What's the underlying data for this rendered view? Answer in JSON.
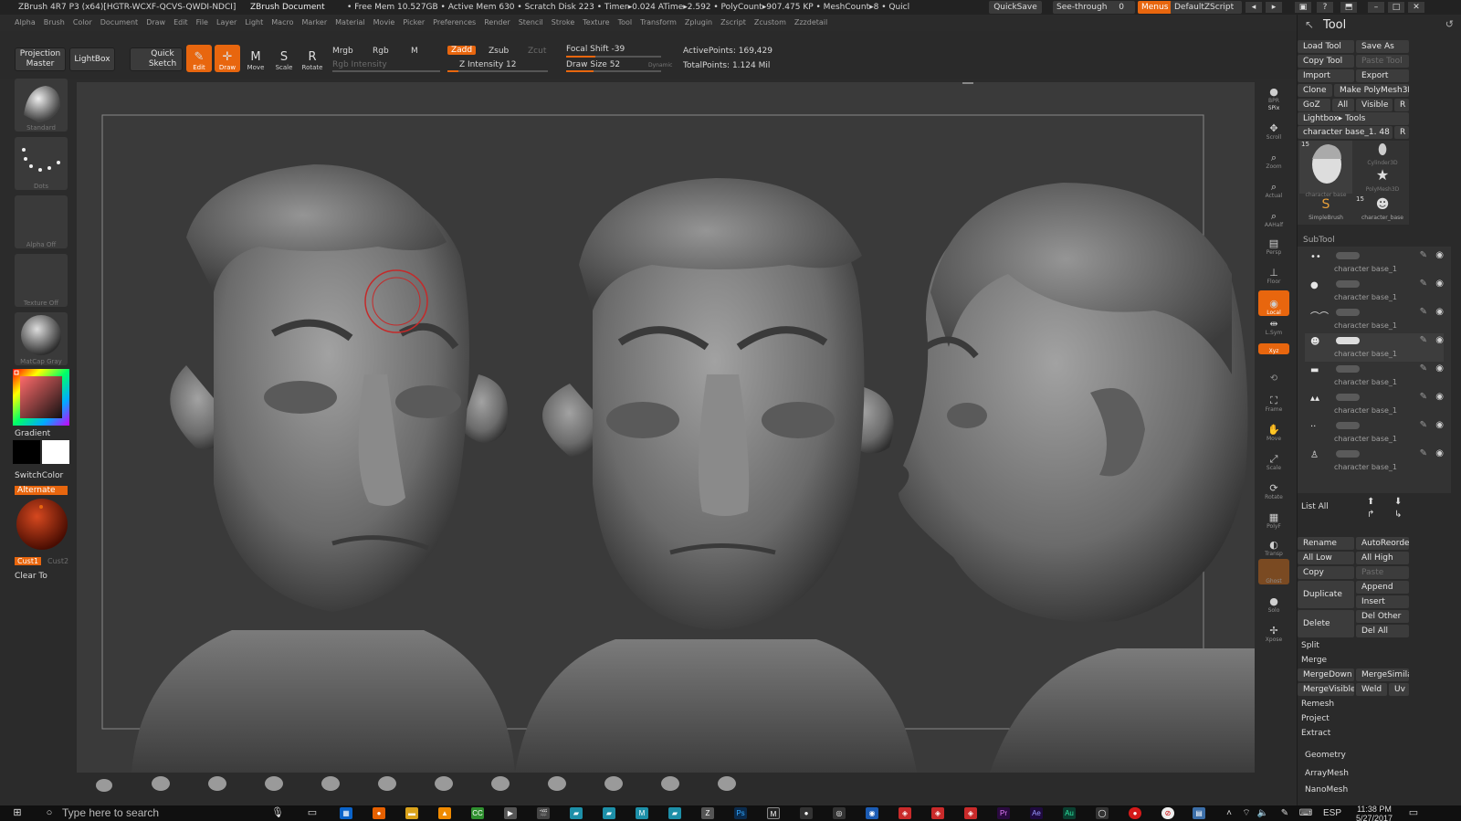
{
  "titlebar": {
    "app_title": "ZBrush 4R7 P3 (x64)[HGTR-WCXF-QCVS-QWDI-NDCI]",
    "document": "ZBrush Document",
    "status": "• Free Mem 10.527GB • Active Mem 630 • Scratch Disk 223 • Timer▸0.024 ATime▸2.592 • PolyCount▸907.475 KP • MeshCount▸8 • Quicl",
    "quicksave": "QuickSave",
    "see_through": "See-through",
    "see_through_value": "0",
    "menus": "Menus",
    "default_zscript": "DefaultZScript"
  },
  "menubar": [
    "Alpha",
    "Brush",
    "Color",
    "Document",
    "Draw",
    "Edit",
    "File",
    "Layer",
    "Light",
    "Macro",
    "Marker",
    "Material",
    "Movie",
    "Picker",
    "Preferences",
    "Render",
    "Stencil",
    "Stroke",
    "Texture",
    "Tool",
    "Transform",
    "Zplugin",
    "Zscript",
    "Zcustom",
    "Zzzdetail"
  ],
  "shelf": {
    "projection_master": "Projection Master",
    "lightbox": "LightBox",
    "quick_sketch": "Quick Sketch",
    "edit": "Edit",
    "draw": "Draw",
    "move": "Move",
    "scale": "Scale",
    "rotate": "Rotate",
    "mrgb": "Mrgb",
    "rgb": "Rgb",
    "m": "M",
    "rgb_intensity": "Rgb Intensity",
    "zadd": "Zadd",
    "zsub": "Zsub",
    "zcut": "Zcut",
    "z_intensity": "Z Intensity 12",
    "focal_shift": "Focal Shift -39",
    "draw_size": "Draw Size 52",
    "dynamic": "Dynamic",
    "active_points": "ActivePoints: 169,429",
    "total_points": "TotalPoints: 1.124 Mil"
  },
  "lefttray": {
    "brush": "Standard",
    "stroke": "Dots",
    "alpha": "Alpha Off",
    "texture": "Texture Off",
    "material": "MatCap Gray",
    "gradient": "Gradient",
    "switchcolor": "SwitchColor",
    "alternate": "Alternate",
    "cust1": "Cust1",
    "cust2": "Cust2",
    "clear_to": "Clear To"
  },
  "rightdock": [
    "BPR",
    "SPix",
    "Scroll",
    "Zoom",
    "Actual",
    "AAHalf",
    "Persp",
    "Floor",
    "Local",
    "L.Sym",
    "Xyz",
    "Frame",
    "Move",
    "Scale",
    "Rotate",
    "PolyF",
    "Transp",
    "Ghost",
    "Solo",
    "Xpose"
  ],
  "tool": {
    "title": "Tool",
    "load_tool": "Load Tool",
    "save_as": "Save As",
    "copy_tool": "Copy Tool",
    "paste_tool": "Paste Tool",
    "import": "Import",
    "export": "Export",
    "clone": "Clone",
    "make_polymesh": "Make PolyMesh3D",
    "goz": "GoZ",
    "all": "All",
    "visible": "Visible",
    "r": "R",
    "lightbox_tools": "Lightbox▸ Tools",
    "current_tool": "character base_1. 48",
    "thumbs": [
      "character base",
      "Cylinder3D",
      "PolyMesh3D",
      "SimpleBrush",
      "character_base"
    ],
    "thumb_counts": [
      "15",
      "15"
    ],
    "subtool_header": "SubTool",
    "subtools": [
      "character base_1",
      "character base_1",
      "character base_1",
      "character base_1",
      "character base_1",
      "character base_1",
      "character base_1",
      "character base_1"
    ],
    "list_all": "List All",
    "rename": "Rename",
    "autoreorder": "AutoReorde",
    "all_low": "All Low",
    "all_high": "All High",
    "copy": "Copy",
    "paste": "Paste",
    "duplicate": "Duplicate",
    "append": "Append",
    "insert": "Insert",
    "delete": "Delete",
    "del_other": "Del Other",
    "del_all": "Del All",
    "split": "Split",
    "merge": "Merge",
    "mergedown": "MergeDown",
    "mergesimilar": "MergeSimila",
    "mergevisible": "MergeVisible",
    "weld": "Weld",
    "uv": "Uv",
    "remesh": "Remesh",
    "project": "Project",
    "extract": "Extract",
    "geometry": "Geometry",
    "arraymesh": "ArrayMesh",
    "nanomesh": "NanoMesh"
  },
  "taskbar": {
    "search_placeholder": "Type here to search",
    "language": "ESP",
    "time": "11:38 PM",
    "date": "5/27/2017"
  },
  "colors": {
    "accent": "#e8660e",
    "panel": "#2a2a2a",
    "canvas": "#3a3a3a"
  }
}
